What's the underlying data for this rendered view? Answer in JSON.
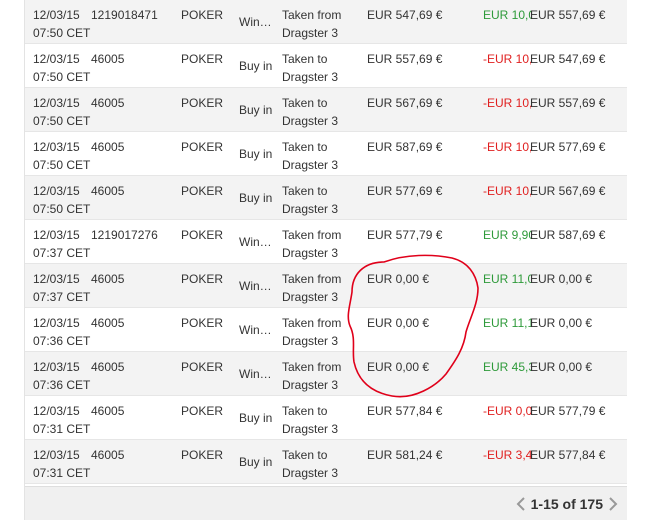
{
  "rows": [
    {
      "date": "12/03/15 07:50 CET",
      "ref": "1219018471",
      "game": "POKER",
      "type": "Winni...",
      "desc": "Taken from Dragster 3",
      "before": "EUR 547,69 €",
      "amount": "EUR 10,0",
      "amount_sign": "pos",
      "after": "EUR 557,69 €"
    },
    {
      "date": "12/03/15 07:50 CET",
      "ref": "46005",
      "game": "POKER",
      "type": "Buy in",
      "desc": "Taken to Dragster 3",
      "before": "EUR 557,69 €",
      "amount": "-EUR 10,",
      "amount_sign": "neg",
      "after": "EUR 547,69 €"
    },
    {
      "date": "12/03/15 07:50 CET",
      "ref": "46005",
      "game": "POKER",
      "type": "Buy in",
      "desc": "Taken to Dragster 3",
      "before": "EUR 567,69 €",
      "amount": "-EUR 10,",
      "amount_sign": "neg",
      "after": "EUR 557,69 €"
    },
    {
      "date": "12/03/15 07:50 CET",
      "ref": "46005",
      "game": "POKER",
      "type": "Buy in",
      "desc": "Taken to Dragster 3",
      "before": "EUR 587,69 €",
      "amount": "-EUR 10,",
      "amount_sign": "neg",
      "after": "EUR 577,69 €"
    },
    {
      "date": "12/03/15 07:50 CET",
      "ref": "46005",
      "game": "POKER",
      "type": "Buy in",
      "desc": "Taken to Dragster 3",
      "before": "EUR 577,69 €",
      "amount": "-EUR 10,",
      "amount_sign": "neg",
      "after": "EUR 567,69 €"
    },
    {
      "date": "12/03/15 07:37 CET",
      "ref": "1219017276",
      "game": "POKER",
      "type": "Winni...",
      "desc": "Taken from Dragster 3",
      "before": "EUR 577,79 €",
      "amount": "EUR 9,90",
      "amount_sign": "pos",
      "after": "EUR 587,69 €"
    },
    {
      "date": "12/03/15 07:37 CET",
      "ref": "46005",
      "game": "POKER",
      "type": "Winni...",
      "desc": "Taken from Dragster 3",
      "before": "EUR 0,00 €",
      "amount": "EUR 11,0",
      "amount_sign": "pos",
      "after": "EUR 0,00 €"
    },
    {
      "date": "12/03/15 07:36 CET",
      "ref": "46005",
      "game": "POKER",
      "type": "Winni...",
      "desc": "Taken from Dragster 3",
      "before": "EUR 0,00 €",
      "amount": "EUR 11,1",
      "amount_sign": "pos",
      "after": "EUR 0,00 €"
    },
    {
      "date": "12/03/15 07:36 CET",
      "ref": "46005",
      "game": "POKER",
      "type": "Winni...",
      "desc": "Taken from Dragster 3",
      "before": "EUR 0,00 €",
      "amount": "EUR 45,3",
      "amount_sign": "pos",
      "after": "EUR 0,00 €"
    },
    {
      "date": "12/03/15 07:31 CET",
      "ref": "46005",
      "game": "POKER",
      "type": "Buy in",
      "desc": "Taken to Dragster 3",
      "before": "EUR 577,84 €",
      "amount": "-EUR 0,0",
      "amount_sign": "neg",
      "after": "EUR 577,79 €"
    },
    {
      "date": "12/03/15 07:31 CET",
      "ref": "46005",
      "game": "POKER",
      "type": "Buy in",
      "desc": "Taken to Dragster 3",
      "before": "EUR 581,24 €",
      "amount": "-EUR 3,4",
      "amount_sign": "neg",
      "after": "EUR 577,84 €"
    }
  ],
  "pagination": {
    "label": "1-15 of 175",
    "prev_icon": "chevron-left-icon",
    "next_icon": "chevron-right-icon"
  },
  "colors": {
    "positive": "#2e9a3a",
    "negative": "#e02020",
    "annotation": "#e0001a",
    "row_alt": "#f3f3f3"
  }
}
